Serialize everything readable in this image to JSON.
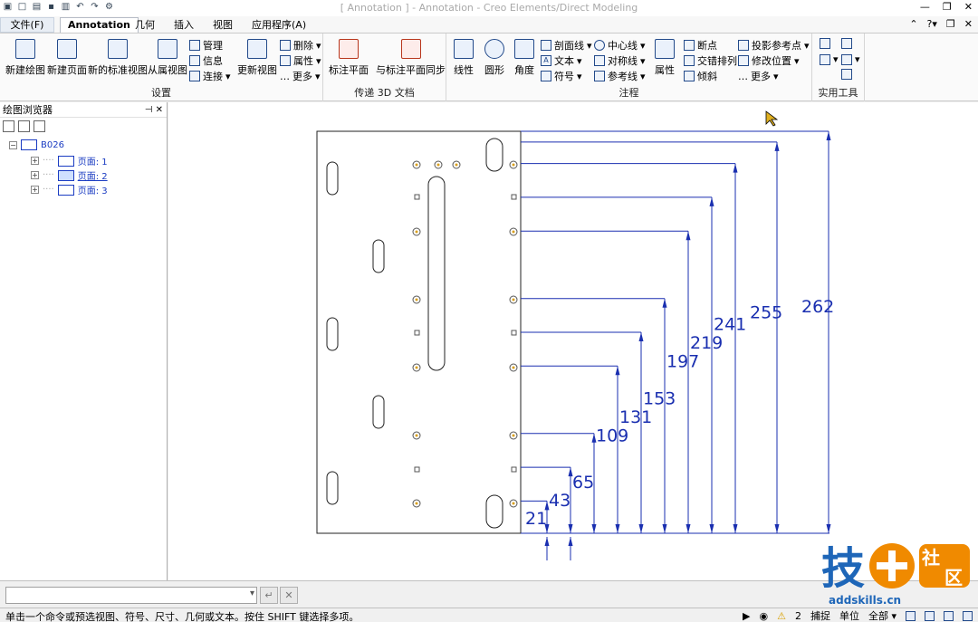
{
  "window": {
    "title": "[ Annotation ] - Annotation - Creo Elements/Direct Modeling"
  },
  "tabs": [
    {
      "label": "文件(F)"
    },
    {
      "label": "Annotation"
    },
    {
      "label": "几何"
    },
    {
      "label": "插入"
    },
    {
      "label": "视图"
    },
    {
      "label": "应用程序(A)"
    }
  ],
  "ribbon": {
    "settings": {
      "label": "设置",
      "new_drawing": "新建绘图",
      "new_page": "新建页面",
      "new_std_view": "新的标准视图",
      "from_view": "从属视图",
      "manage": "管理",
      "info": "信息",
      "connect": "连接",
      "update_view": "更新视图",
      "delete": "删除",
      "properties": "属性",
      "more": "更多"
    },
    "transfer": {
      "label": "传递 3D 文档",
      "annot_plane": "标注平面",
      "sync_plane": "与标注平面同步"
    },
    "annotation": {
      "label": "注程",
      "linear": "线性",
      "round": "圆形",
      "angle": "角度",
      "section_line": "剖面线",
      "text": "文本",
      "symbol": "符号",
      "center_line": "中心线",
      "symmetry": "对称线",
      "reference": "参考线",
      "attributes": "属性",
      "break": "断点",
      "stagger": "交错排列",
      "tilt": "倾斜",
      "proj_ref": "投影参考点",
      "modify_pos": "修改位置",
      "more": "更多"
    },
    "utility": {
      "label": "实用工具"
    }
  },
  "browser": {
    "title": "绘图浏览器",
    "root": "B026",
    "pages": [
      "页面: 1",
      "页面: 2",
      "页面: 3"
    ]
  },
  "drawing": {
    "dimensions": [
      "21",
      "43",
      "65",
      "109",
      "131",
      "153",
      "197",
      "219",
      "241",
      "255",
      "262"
    ]
  },
  "command": {
    "input": ""
  },
  "status": {
    "message": "单击一个命令或预选视图、符号、尺寸、几何或文本。按住 SHIFT 键选择多项。",
    "count": "2",
    "capture": "捕捉",
    "unit": "单位",
    "filter": "全部"
  },
  "watermark": {
    "brand": "技术社区",
    "url": "addskills.cn"
  }
}
